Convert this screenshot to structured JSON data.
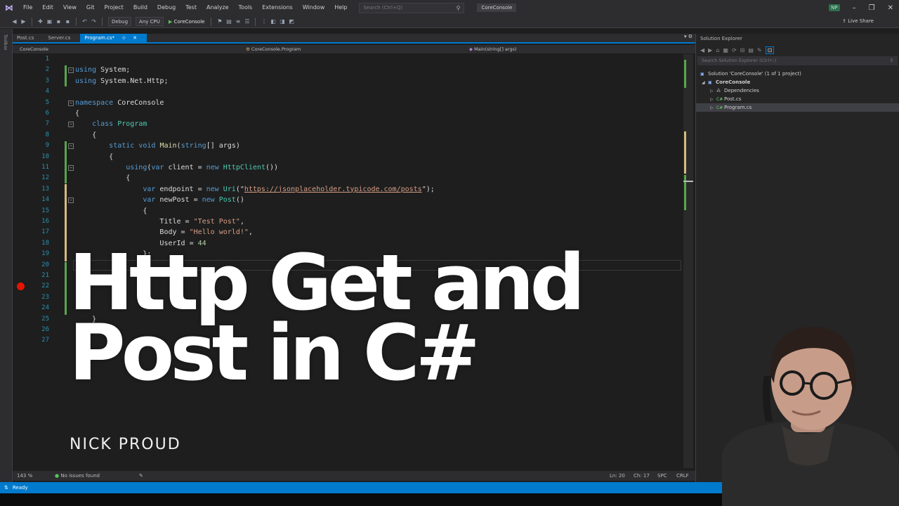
{
  "menubar": {
    "logo": "⋈",
    "items": [
      "File",
      "Edit",
      "View",
      "Git",
      "Project",
      "Build",
      "Debug",
      "Test",
      "Analyze",
      "Tools",
      "Extensions",
      "Window",
      "Help"
    ],
    "search_placeholder": "Search (Ctrl+Q)",
    "project_name": "CoreConsole",
    "user_initials": "NP"
  },
  "toolbar": {
    "config": "Debug",
    "platform": "Any CPU",
    "run_label": "CoreConsole",
    "live_share": "Live Share"
  },
  "left_strip_label": "Toolbox",
  "tabs": [
    {
      "label": "Post.cs",
      "active": false
    },
    {
      "label": "Server.cs",
      "active": false
    },
    {
      "label": "Program.cs*",
      "active": true
    }
  ],
  "navbar": {
    "project": "CoreConsole",
    "class": "CoreConsole.Program",
    "member": "Main(string[] args)"
  },
  "code_lines": [
    {
      "n": "1"
    },
    {
      "n": "2"
    },
    {
      "n": "3"
    },
    {
      "n": "4"
    },
    {
      "n": "5"
    },
    {
      "n": "6"
    },
    {
      "n": "7"
    },
    {
      "n": "8"
    },
    {
      "n": "9"
    },
    {
      "n": "10"
    },
    {
      "n": "11"
    },
    {
      "n": "12"
    },
    {
      "n": "13"
    },
    {
      "n": "14"
    },
    {
      "n": "15"
    },
    {
      "n": "16"
    },
    {
      "n": "17"
    },
    {
      "n": "18"
    },
    {
      "n": "19"
    },
    {
      "n": "20"
    },
    {
      "n": "21"
    },
    {
      "n": "22"
    },
    {
      "n": "23"
    },
    {
      "n": "24"
    },
    {
      "n": "25"
    },
    {
      "n": "26"
    },
    {
      "n": "27"
    }
  ],
  "code": {
    "l2_kw": "using",
    "l2_rest": " System;",
    "l3_kw": "using",
    "l3_rest": " System.Net.Http;",
    "l5_kw": "namespace",
    "l5_rest": " CoreConsole",
    "l6": "{",
    "l7_kw": "class",
    "l7_ty": "Program",
    "l8": "{",
    "l9_kw1": "static",
    "l9_kw2": "void",
    "l9_mt": "Main",
    "l9_open": "(",
    "l9_kw3": "string",
    "l9_rest": "[] args)",
    "l10": "{",
    "l11_kw1": "using",
    "l11_open": "(",
    "l11_kw2": "var",
    "l11_mid": " client = ",
    "l11_kw3": "new",
    "l11_ty": "HttpClient",
    "l11_close": "())",
    "l12": "{",
    "l13_kw1": "var",
    "l13_mid": " endpoint = ",
    "l13_kw2": "new",
    "l13_ty": "Uri",
    "l13_open": "(\"",
    "l13_url": "https://jsonplaceholder.typicode.com/posts",
    "l13_close": "\");",
    "l14_kw1": "var",
    "l14_mid": " newPost = ",
    "l14_kw2": "new",
    "l14_ty": "Post",
    "l14_close": "()",
    "l15": "{",
    "l16_pre": "Title = ",
    "l16_st": "\"Test Post\"",
    "l16_post": ",",
    "l17_pre": "Body = ",
    "l17_st": "\"Hello world!\"",
    "l17_post": ",",
    "l18_pre": "UserId = ",
    "l18_nu": "44",
    "l19": "};",
    "l25": "}",
    "l26": "}"
  },
  "solution_explorer": {
    "title": "Solution Explorer",
    "search_placeholder": "Search Solution Explorer (Ctrl+;)",
    "solution": "Solution 'CoreConsole' (1 of 1 project)",
    "project": "CoreConsole",
    "dependencies": "Dependencies",
    "file1": "Post.cs",
    "file2": "Program.cs"
  },
  "editor_status": {
    "zoom": "143 %",
    "issues": "No issues found",
    "line": "Ln: 20",
    "col": "Ch: 17",
    "spc": "SPC",
    "crlf": "CRLF"
  },
  "status": {
    "ready": "Ready"
  },
  "overlay": {
    "title_line1": "Http Get and",
    "title_line2": "Post in C#",
    "author": "NICK PROUD"
  },
  "colors": {
    "accent": "#007acc",
    "keyword": "#569cd6",
    "type": "#4ec9b0",
    "string": "#d69d85",
    "line_number": "#2b91af",
    "breakpoint": "#e51400"
  }
}
